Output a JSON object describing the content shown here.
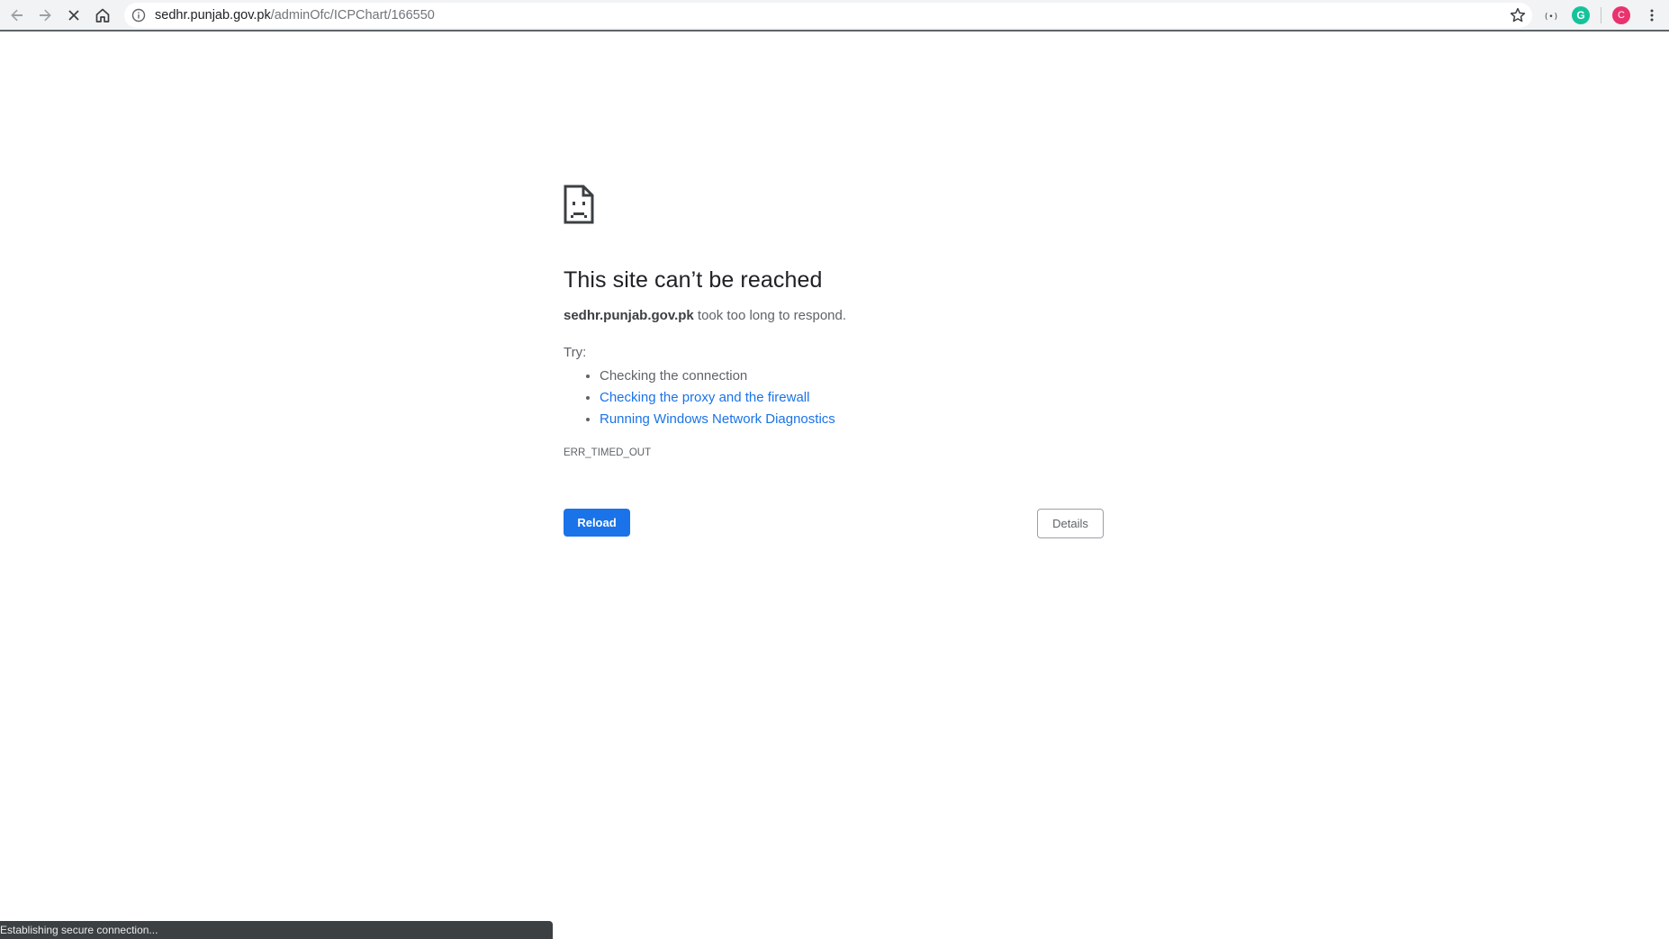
{
  "browser": {
    "url_host": "sedhr.punjab.gov.pk",
    "url_path": "/adminOfc/ICPChart/166550",
    "profile_initial": "C",
    "grammarly_label": "G",
    "icons": {
      "back": "arrow-left-icon",
      "forward": "arrow-right-icon",
      "stop": "close-icon",
      "home": "home-icon",
      "site_info": "info-icon",
      "bookmark": "star-icon",
      "extension": "extension-icon",
      "menu": "kebab-menu-icon"
    }
  },
  "error_page": {
    "title": "This site can’t be reached",
    "host": "sedhr.punjab.gov.pk",
    "message": " took too long to respond.",
    "try_label": "Try:",
    "suggestions": [
      {
        "text": "Checking the connection",
        "link": false
      },
      {
        "text": "Checking the proxy and the firewall",
        "link": true
      },
      {
        "text": "Running Windows Network Diagnostics",
        "link": true
      }
    ],
    "error_code": "ERR_TIMED_OUT",
    "reload_label": "Reload",
    "details_label": "Details"
  },
  "status_bar": {
    "text": "Establishing secure connection..."
  },
  "colors": {
    "primary_blue": "#1a73e8",
    "link_blue": "#1a73e8",
    "text_gray": "#5f6368",
    "title_dark": "#202124",
    "toolbar_bg": "#f1f3f4"
  }
}
